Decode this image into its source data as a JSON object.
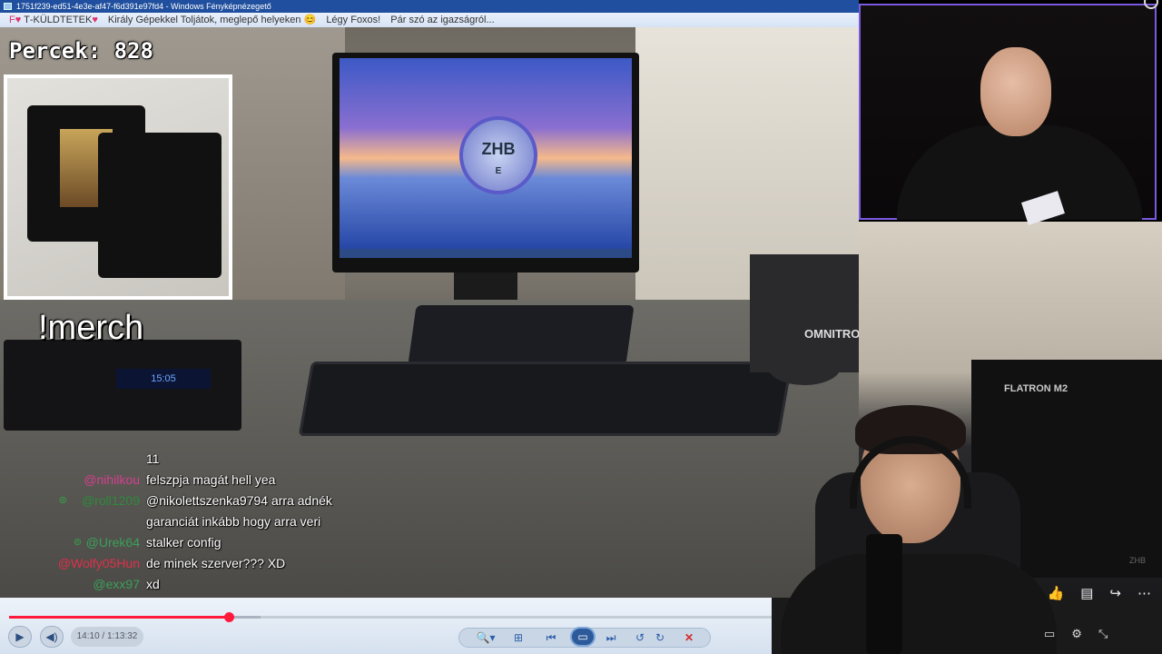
{
  "viewer": {
    "title": "1751f239-ed51-4e3e-af47-f6d391e97fd4 - Windows Fényképnézegető",
    "ticker_prefix": "F♥",
    "ticker_1": "T‑KÜLDTETEK",
    "ticker_2": "Király Gépekkel Toljátok, meglepő helyeken 😊",
    "ticker_3": "Légy Foxos!",
    "ticker_4": "Pár szó az igazságról..."
  },
  "overlay": {
    "timer_label": "Percek:",
    "timer_value": "828",
    "merch_command": "!merch"
  },
  "scene": {
    "monitor_emblem": "ZHB",
    "monitor_emblem_sub": "E",
    "pc_clock": "15:05",
    "mixer_brand": "OMNITRONIC",
    "speaker_brand": "FLATRON M2",
    "watermark": "ZHB"
  },
  "chat": {
    "messages": [
      {
        "user": "",
        "user_color": "#ffffff",
        "badge": "",
        "text": "11"
      },
      {
        "user": "@nihilkou",
        "user_color": "#d63f8f",
        "badge": "",
        "text": "felszpja magát hell yea"
      },
      {
        "user": "@roll1209",
        "user_color": "#2e8b3d",
        "badge": "⊚",
        "text": "@nikolettszenka9794 arra adnék"
      },
      {
        "user": "",
        "user_color": "#ffffff",
        "badge": "",
        "text": "garanciát inkább hogy arra veri"
      },
      {
        "user": "@Urek64",
        "user_color": "#3aa05a",
        "badge": "⊚",
        "text": "stalker config"
      },
      {
        "user": "@Wolfy05Hun",
        "user_color": "#e0304a",
        "badge": "",
        "text": "de minek szerver??? XD"
      },
      {
        "user": "@exx97",
        "user_color": "#3aa05a",
        "badge": "",
        "text": "xd"
      }
    ]
  },
  "player": {
    "progress_fraction": 0.288,
    "buffer_fraction": 0.33,
    "time": "14:10 / 1:13:32",
    "play_icon": "▶",
    "volume_icon": "◀)"
  },
  "nav": {
    "zoom": "🔍▾",
    "fit": "⊞",
    "prev": "⏮",
    "slideshow": "▭",
    "next": "⏭",
    "rotate_left": "↺",
    "rotate_right": "↻",
    "delete": "✕"
  },
  "video_actions": {
    "like": "👍",
    "comment": "▤",
    "share": "↪",
    "more": "⋯"
  },
  "right_controls": {
    "captions": "▭",
    "settings": "⚙",
    "fullscreen": "⤡"
  },
  "colors": {
    "accent_red": "#ff1a3a",
    "cam_border": "#7b5ae0",
    "titlebar": "#1f4f9e"
  }
}
